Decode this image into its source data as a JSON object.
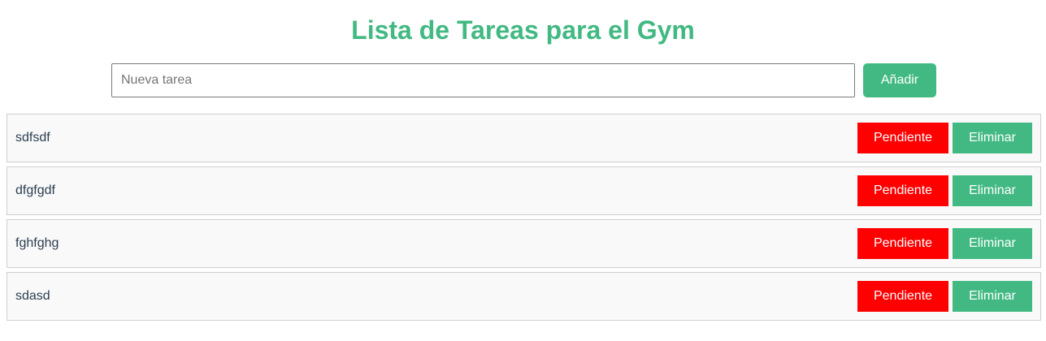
{
  "header": {
    "title": "Lista de Tareas para el Gym"
  },
  "new_task": {
    "placeholder": "Nueva tarea",
    "value": "",
    "add_label": "Añadir"
  },
  "tasks": [
    {
      "text": "sdfsdf",
      "status_label": "Pendiente",
      "delete_label": "Eliminar"
    },
    {
      "text": "dfgfgdf",
      "status_label": "Pendiente",
      "delete_label": "Eliminar"
    },
    {
      "text": "fghfghg",
      "status_label": "Pendiente",
      "delete_label": "Eliminar"
    },
    {
      "text": "sdasd",
      "status_label": "Pendiente",
      "delete_label": "Eliminar"
    }
  ],
  "colors": {
    "accent": "#42b983",
    "pending": "#ff0000",
    "row_background": "#f9f9f9"
  }
}
